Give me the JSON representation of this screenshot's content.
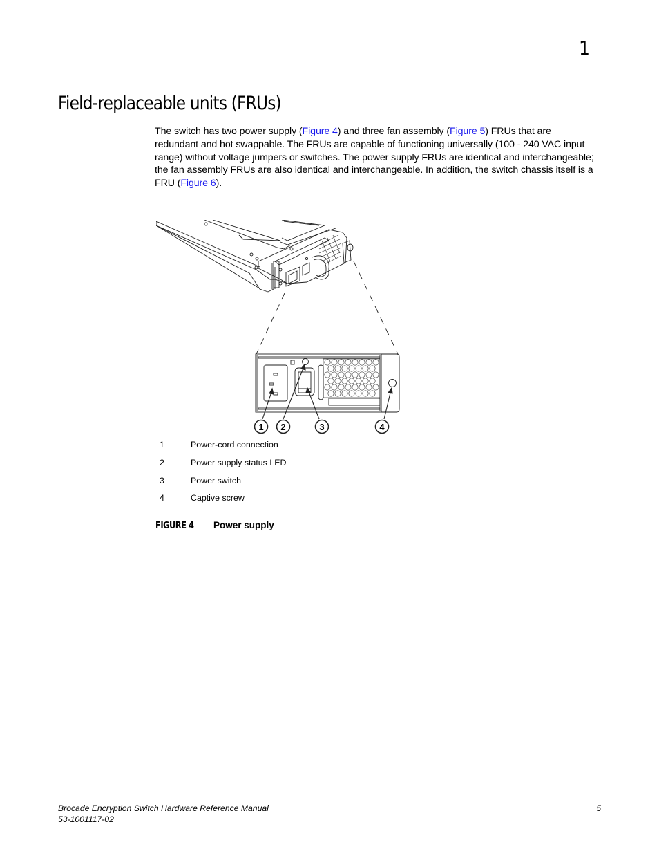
{
  "header": {
    "chapter_number": "1"
  },
  "page_title": "Field-replaceable units (FRUs)",
  "body": {
    "segments": [
      {
        "text": "The switch has two power supply ("
      },
      {
        "text": "Figure 4",
        "link": true
      },
      {
        "text": ") and three fan assembly ("
      },
      {
        "text": "Figure 5",
        "link": true
      },
      {
        "text": ") FRUs that are redundant and hot swappable. The FRUs are capable of functioning universally (100 - 240 VAC input range) without voltage jumpers or switches. The power supply FRUs are identical and interchangeable; the fan assembly FRUs are also identical and interchangeable. In addition, the switch chassis itself is a FRU ("
      },
      {
        "text": "Figure 6",
        "link": true
      },
      {
        "text": ")."
      }
    ],
    "link_color": "#1a1aee"
  },
  "figure": {
    "callouts": [
      "1",
      "2",
      "3",
      "4"
    ],
    "legend": [
      {
        "num": "1",
        "label": "Power-cord connection"
      },
      {
        "num": "2",
        "label": "Power supply status LED"
      },
      {
        "num": "3",
        "label": "Power switch"
      },
      {
        "num": "4",
        "label": "Captive screw"
      }
    ],
    "caption_label": "FIGURE 4",
    "caption_title": "Power supply"
  },
  "footer": {
    "manual_title": "Brocade Encryption Switch Hardware Reference Manual",
    "doc_number": "53-1001117-02",
    "page_number": "5"
  }
}
